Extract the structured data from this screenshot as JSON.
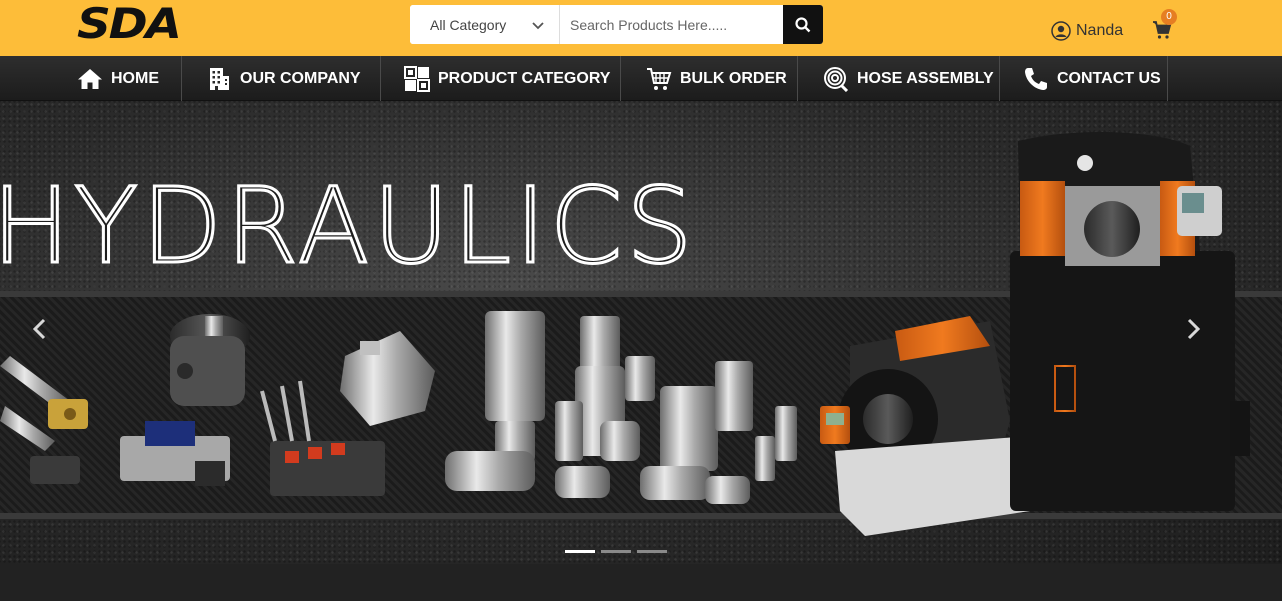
{
  "brand": {
    "logo_text": "SDA",
    "accent_color": "#fdbd39"
  },
  "search": {
    "category_label": "All Category",
    "placeholder": "Search Products Here.....",
    "value": ""
  },
  "user": {
    "name": "Nanda"
  },
  "cart": {
    "count": "0"
  },
  "nav": {
    "items": [
      {
        "label": "HOME",
        "icon": "home-icon"
      },
      {
        "label": "OUR COMPANY",
        "icon": "building-icon"
      },
      {
        "label": "PRODUCT CATEGORY",
        "icon": "grid-icon"
      },
      {
        "label": "BULK ORDER",
        "icon": "cart-icon"
      },
      {
        "label": "HOSE ASSEMBLY",
        "icon": "hose-icon"
      },
      {
        "label": "CONTACT US",
        "icon": "phone-icon"
      }
    ]
  },
  "hero": {
    "title": "HYDRAULICS",
    "slides_total": 3,
    "active_slide": 1
  }
}
